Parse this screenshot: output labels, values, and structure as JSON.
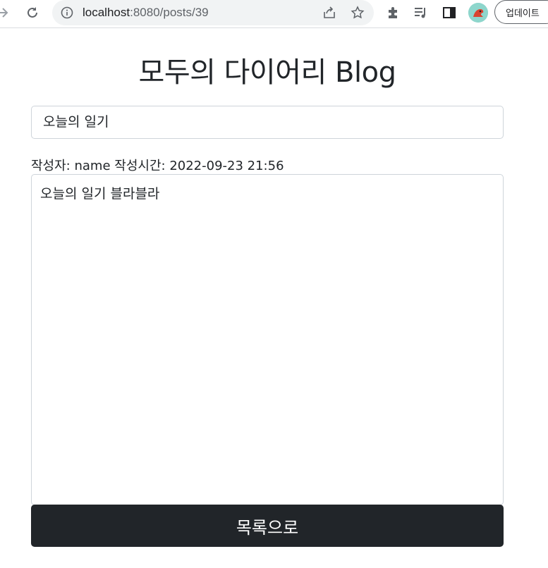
{
  "browser": {
    "url_host": "localhost",
    "url_rest": ":8080/posts/39",
    "update_label": "업데이트"
  },
  "page": {
    "title": "모두의 다이어리 Blog",
    "post_title": "오늘의 일기",
    "author_label": "작성자:",
    "author": "name",
    "time_label": "작성시간:",
    "time": "2022-09-23 21:56",
    "content": "오늘의 일기 블라블라",
    "list_button": "목록으로"
  },
  "colors": {
    "button_bg": "#212529",
    "border": "#ced4da"
  }
}
